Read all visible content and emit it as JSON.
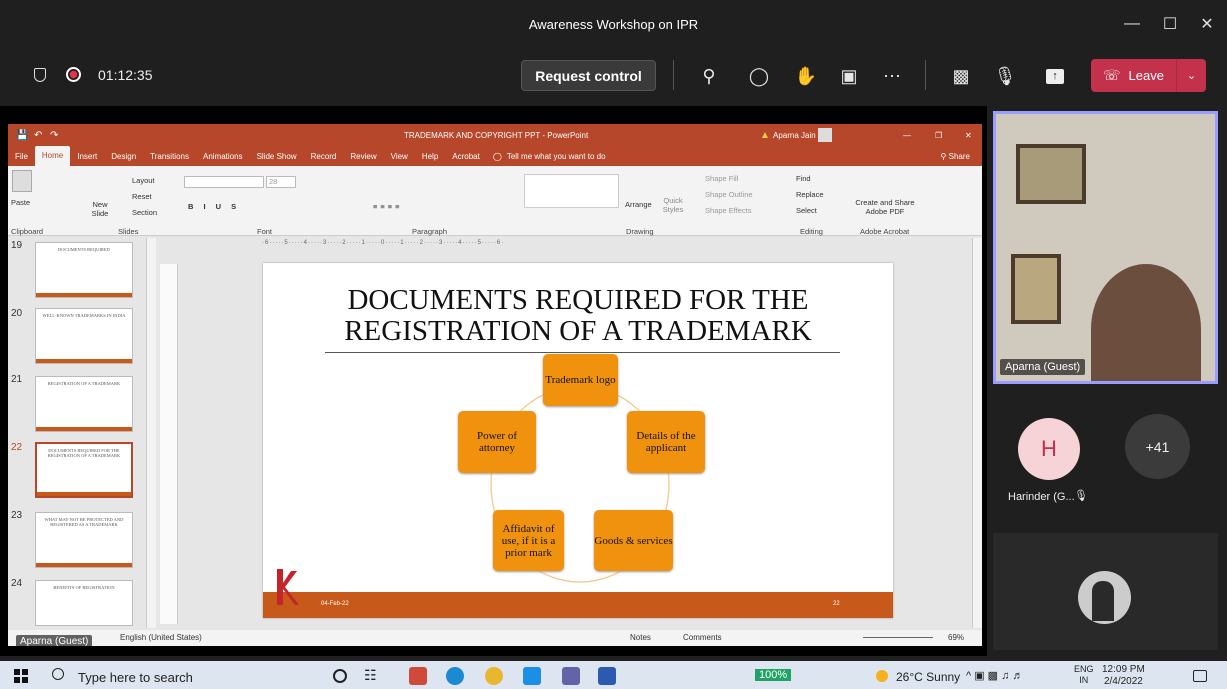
{
  "window": {
    "title": "Awareness Workshop on IPR",
    "minimize": "—",
    "maximize": "☐",
    "close": "✕"
  },
  "call": {
    "timer": "01:12:35",
    "request_control": "Request control",
    "leave": "Leave",
    "icons": [
      "shield-icon",
      "record-icon",
      "people-icon",
      "chat-icon",
      "raise-hand-icon",
      "rooms-icon",
      "more-icon",
      "camera-off-icon",
      "mic-off-icon",
      "share-icon"
    ]
  },
  "powerpoint": {
    "window_title": "TRADEMARK AND COPYRIGHT PPT - PowerPoint",
    "user": "Aparna Jain",
    "share_label": "Share",
    "tabs": [
      "File",
      "Home",
      "Insert",
      "Design",
      "Transitions",
      "Animations",
      "Slide Show",
      "Record",
      "Review",
      "View",
      "Help",
      "Acrobat"
    ],
    "tell_me": "Tell me what you want to do",
    "ribbon_groups": [
      "Clipboard",
      "Slides",
      "Font",
      "Paragraph",
      "Drawing",
      "Editing",
      "Adobe Acrobat"
    ],
    "ribbon_items": {
      "paste": "Paste",
      "new_slide": "New Slide",
      "layout": "Layout",
      "reset": "Reset",
      "section": "Section",
      "font_size": "28",
      "arrange": "Arrange",
      "quick_styles": "Quick Styles",
      "shape_fill": "Shape Fill",
      "shape_outline": "Shape Outline",
      "shape_effects": "Shape Effects",
      "find": "Find",
      "replace": "Replace",
      "select": "Select",
      "create_share": "Create and Share Adobe PDF"
    },
    "ruler_text": "·6·····5·····4·····3·····2·····1·····0·····1·····2·····3·····4·····5·····6·",
    "thumbnails": [
      {
        "num": "19",
        "title": "DOCUMENTS REQUIRED"
      },
      {
        "num": "20",
        "title": "WELL-KNOWN TRADEMARKS IN INDIA"
      },
      {
        "num": "21",
        "title": "REGISTRATION OF A TRADEMARK"
      },
      {
        "num": "22",
        "title": "DOCUMENTS REQUIRED FOR THE REGISTRATION OF A TRADEMARK"
      },
      {
        "num": "23",
        "title": "WHAT MAY NOT BE PROTECTED AND REGISTERED AS A TRADEMARK"
      },
      {
        "num": "24",
        "title": "BENEFITS OF REGISTRATION"
      }
    ],
    "slide": {
      "title_line1": "DOCUMENTS REQUIRED FOR THE",
      "title_line2": "REGISTRATION OF A TRADEMARK",
      "nodes": [
        "Trademark logo",
        "Details of the applicant",
        "Goods & services",
        "Affidavit of use, if it is a prior mark",
        "Power of attorney"
      ],
      "footer_date": "04-Feb-22",
      "footer_page": "22",
      "accent": "#f0920e",
      "footer_color": "#c75a1a"
    },
    "status": {
      "language": "English (United States)",
      "notes": "Notes",
      "comments": "Comments",
      "zoom": "69%"
    }
  },
  "participants": {
    "video_name": "Aparna (Guest)",
    "bottom_left_name": "Aparna (Guest)",
    "h_initial": "H",
    "h_name": "Harinder (G...",
    "more": "+41"
  },
  "taskbar": {
    "search": "Type here to search",
    "battery": "100%",
    "weather": "26°C  Sunny",
    "lang1": "ENG",
    "lang2": "IN",
    "time": "12:09 PM",
    "date": "2/4/2022"
  }
}
